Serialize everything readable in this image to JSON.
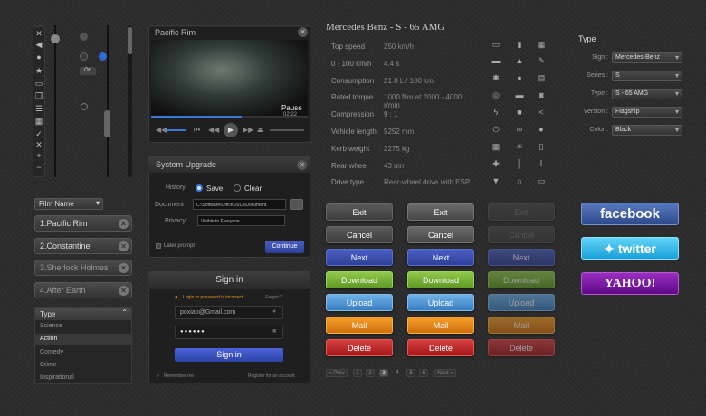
{
  "video": {
    "title": "Pacific Rim",
    "pause": "Pause",
    "time": "02:22"
  },
  "upgrade": {
    "title": "System Upgrade",
    "history_label": "History",
    "save": "Save",
    "clear": "Clear",
    "document_label": "Document",
    "document_value": "C:\\Software\\Office 2013\\Document",
    "privacy_label": "Privacy",
    "privacy_value": "Visible to Everyone",
    "later": "Later prompt",
    "continue": "Continue"
  },
  "signin": {
    "title": "Sign in",
    "error": "Login or password is incorrect",
    "forgot": "Forgot ?",
    "email": "poxiao@Gmail.com",
    "password": "●●●●●●",
    "button": "Sign in",
    "remember": "Remember me",
    "register": "Register for an account"
  },
  "films": {
    "dropdown": "Film Name",
    "items": [
      "1.Pacific Rim",
      "2.Constantine",
      "3.Sherlock Holmes",
      "4.After Earth"
    ]
  },
  "types": {
    "header": "Type",
    "items": [
      "Science",
      "Action",
      "Comedy",
      "Crime",
      "Inspirational"
    ]
  },
  "car": {
    "title": "Mercedes Benz - S - 65 AMG",
    "specs": [
      {
        "k": "Top speed",
        "v": "250 km/h"
      },
      {
        "k": "0 - 100 km/h",
        "v": "4.4 s"
      },
      {
        "k": "Consumption",
        "v": "21.8 L / 100 km"
      },
      {
        "k": "Rated torque",
        "v": "1000 Nm at 2000 - 4000 r/min"
      },
      {
        "k": "Compression",
        "v": "9 : 1"
      },
      {
        "k": "Vehicle length",
        "v": "5252 mm"
      },
      {
        "k": "Kerb weight",
        "v": "2275 kg"
      },
      {
        "k": "Rear wheel",
        "v": "43 mm"
      },
      {
        "k": "Drive type",
        "v": "Rear-wheel drive with ESP"
      }
    ]
  },
  "filter": {
    "title": "Type",
    "rows": [
      {
        "label": "Sign :",
        "value": "Mercedes-Benz"
      },
      {
        "label": "Series :",
        "value": "S"
      },
      {
        "label": "Type :",
        "value": "S - 65 AMG"
      },
      {
        "label": "Version :",
        "value": "Flagship"
      },
      {
        "label": "Color :",
        "value": "Black"
      }
    ]
  },
  "buttons": [
    "Exit",
    "Cancel",
    "Next",
    "Download",
    "Upload",
    "Mail",
    "Delete"
  ],
  "pagination": {
    "prev": "« Prev",
    "pages": [
      "1",
      "2",
      "3",
      "4",
      "5",
      "6"
    ],
    "next": "Next »"
  },
  "social": {
    "facebook": "facebook",
    "twitter": "twitter",
    "yahoo": "YAHOO!"
  },
  "toggle": {
    "on": "On"
  },
  "colors": {
    "facebook": "#3b5998",
    "twitter": "#33ccff",
    "yahoo": "#7b0099",
    "accent_blue": "#3f51c4"
  }
}
